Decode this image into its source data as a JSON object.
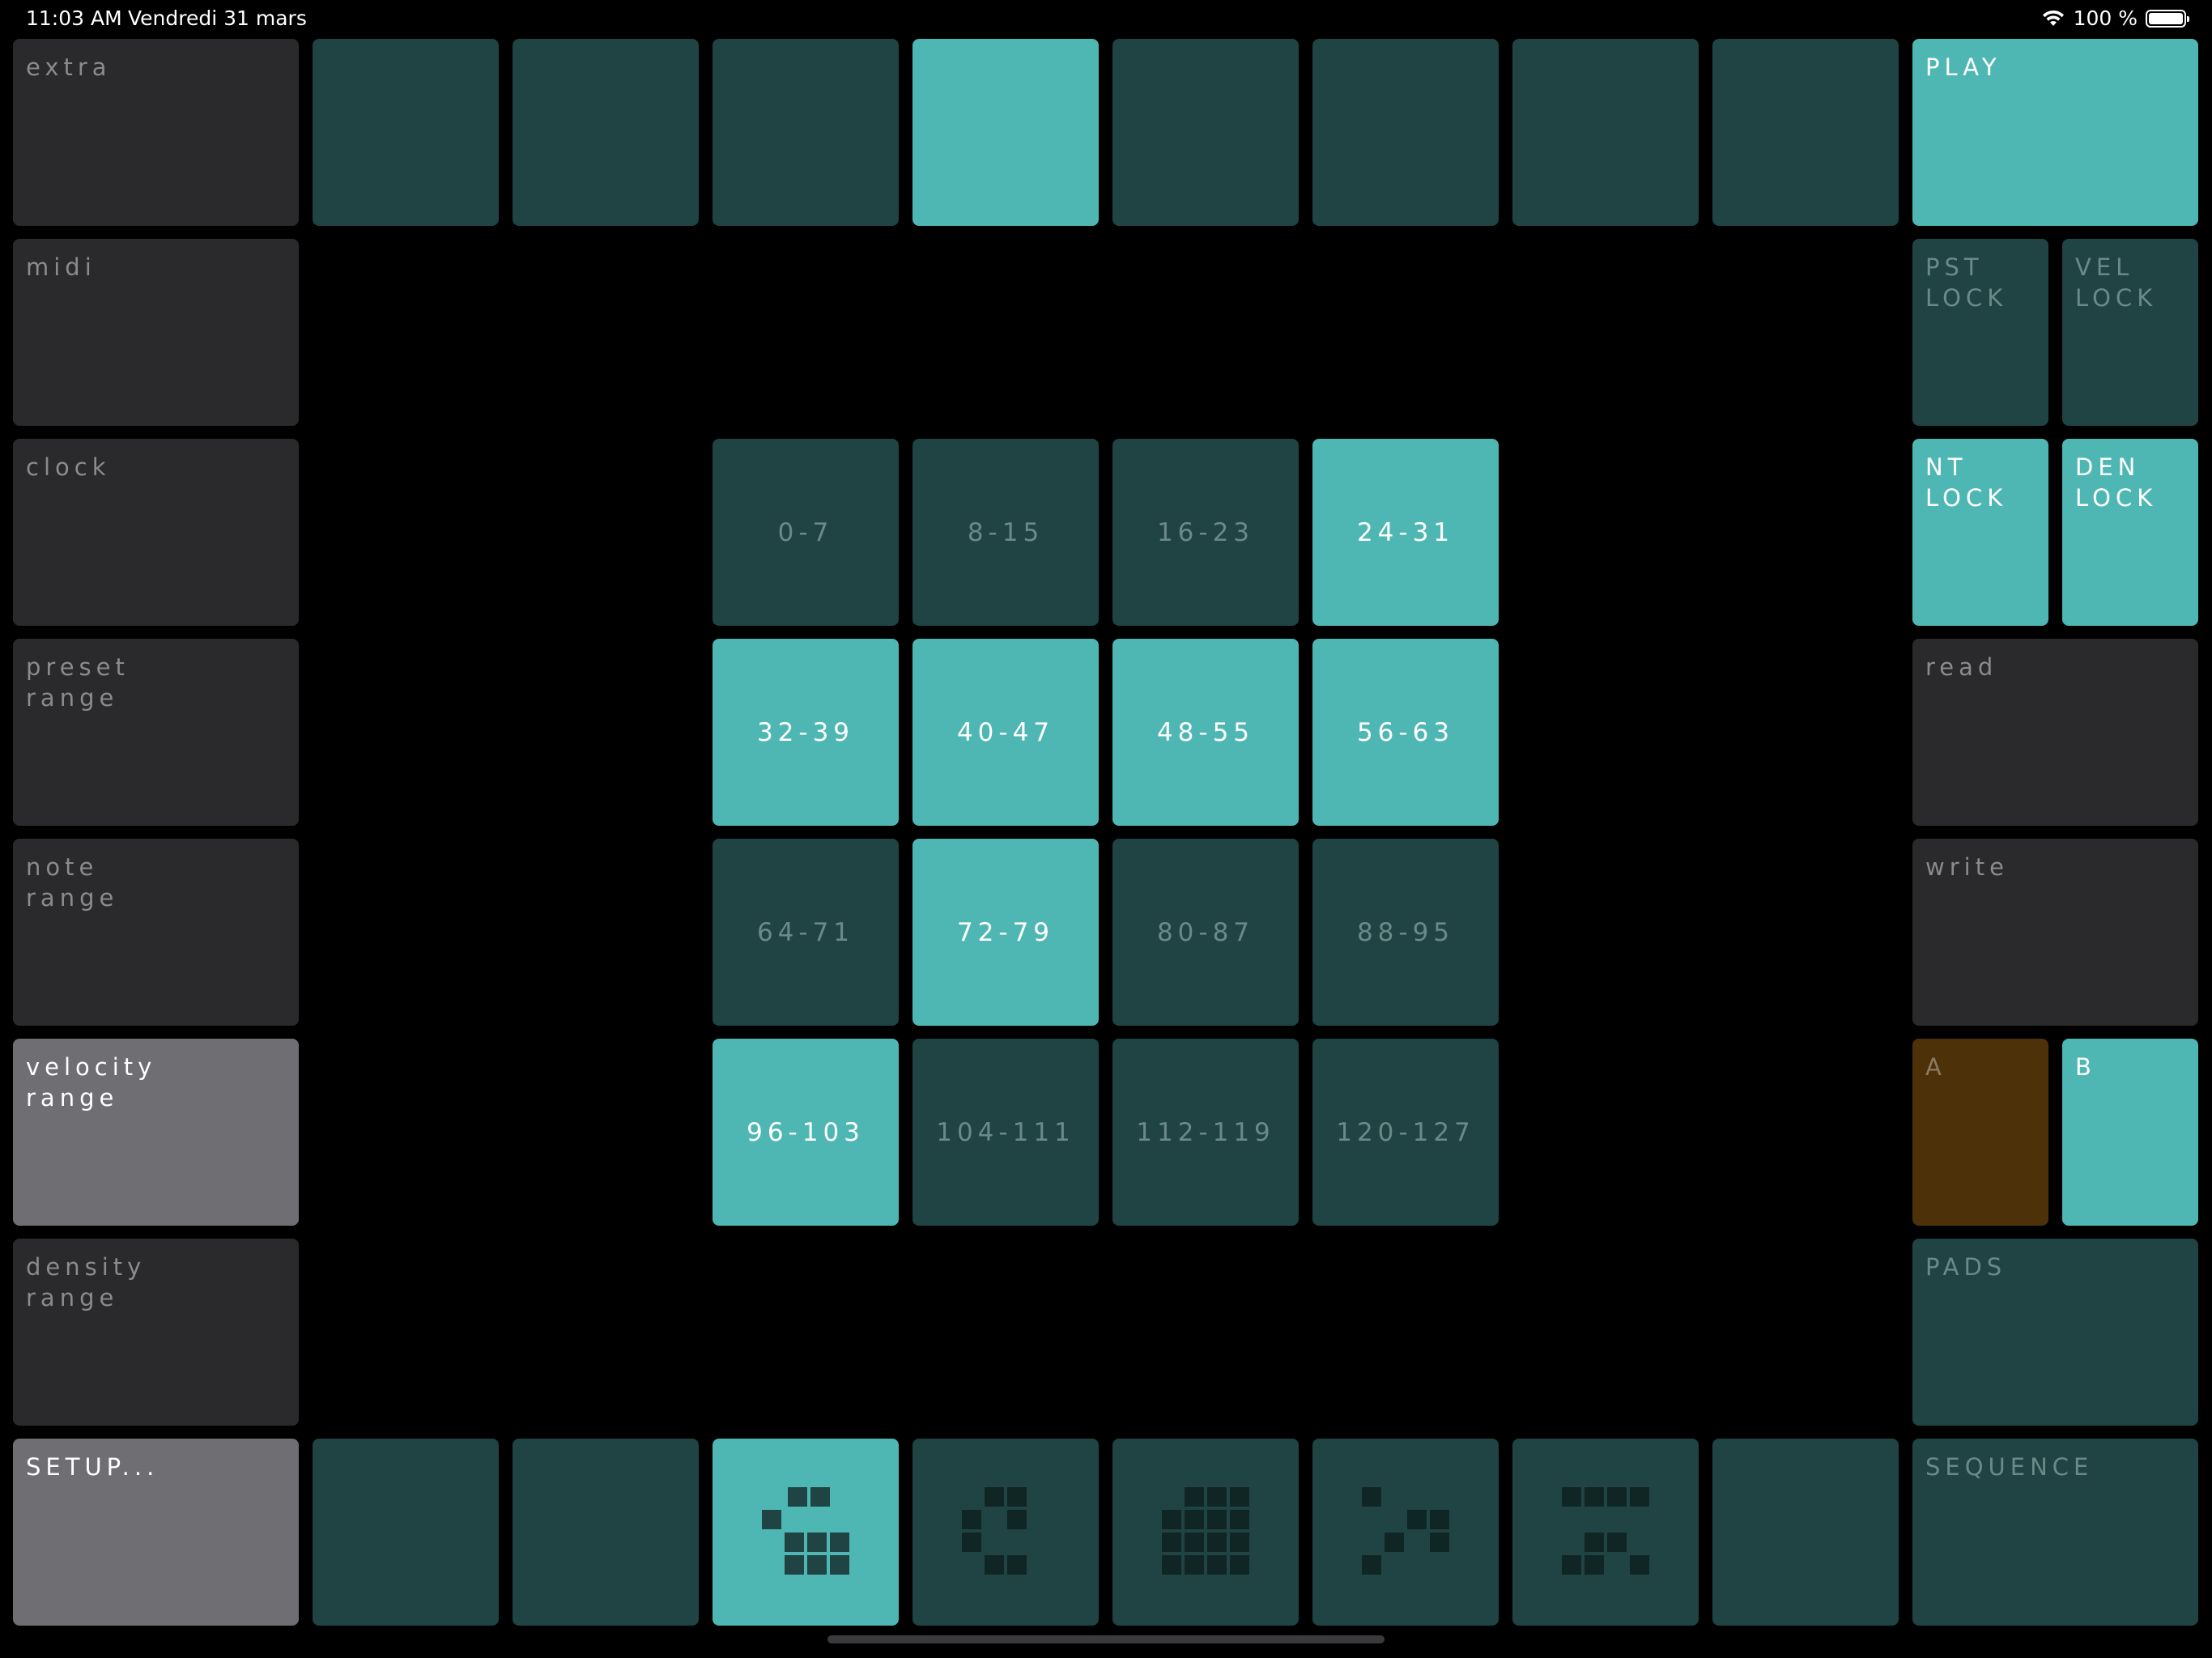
{
  "status_bar": {
    "time": "11:03 AM",
    "date": "Vendredi 31 mars",
    "battery": "100 %"
  },
  "left_column": [
    {
      "label": "extra",
      "active": false
    },
    {
      "label": "midi",
      "active": false
    },
    {
      "label": "clock",
      "active": false
    },
    {
      "label": "preset\nrange",
      "active": false
    },
    {
      "label": "note\nrange",
      "active": false
    },
    {
      "label": "velocity\nrange",
      "active": true
    },
    {
      "label": "density\nrange",
      "active": false
    },
    {
      "label": "SETUP...",
      "active": true
    }
  ],
  "top_row": [
    {
      "active": false
    },
    {
      "active": false
    },
    {
      "active": false
    },
    {
      "active": true
    },
    {
      "active": false
    },
    {
      "active": false
    },
    {
      "active": false
    },
    {
      "active": false
    }
  ],
  "velocity_ranges": [
    {
      "label": "0-7",
      "active": false
    },
    {
      "label": "8-15",
      "active": false
    },
    {
      "label": "16-23",
      "active": false
    },
    {
      "label": "24-31",
      "active": true
    },
    {
      "label": "32-39",
      "active": true
    },
    {
      "label": "40-47",
      "active": true
    },
    {
      "label": "48-55",
      "active": true
    },
    {
      "label": "56-63",
      "active": true
    },
    {
      "label": "64-71",
      "active": false
    },
    {
      "label": "72-79",
      "active": true
    },
    {
      "label": "80-87",
      "active": false
    },
    {
      "label": "88-95",
      "active": false
    },
    {
      "label": "96-103",
      "active": true
    },
    {
      "label": "104-111",
      "active": false
    },
    {
      "label": "112-119",
      "active": false
    },
    {
      "label": "120-127",
      "active": false
    }
  ],
  "right_column": {
    "play": "PLAY",
    "pst_lock": "PST\nLOCK",
    "vel_lock": "VEL\nLOCK",
    "nt_lock": "NT\nLOCK",
    "den_lock": "DEN\nLOCK",
    "read": "read",
    "write": "write",
    "a": "A",
    "b": "B",
    "pads": "PADS",
    "sequence": "SEQUENCE"
  },
  "bottom_row": [
    {
      "pattern": "blank-1",
      "active": false
    },
    {
      "pattern": "blank-2",
      "active": false
    },
    {
      "pattern": "pattern-1",
      "active": true
    },
    {
      "pattern": "pattern-2",
      "active": false
    },
    {
      "pattern": "pattern-3",
      "active": false
    },
    {
      "pattern": "pattern-4",
      "active": false
    },
    {
      "pattern": "pattern-5",
      "active": false
    },
    {
      "pattern": "blank-3",
      "active": false
    }
  ],
  "colors": {
    "teal_on": "#4fb7b3",
    "teal_off": "#1f4443",
    "gray_off": "#2a2a2c",
    "gray_on": "#6e6e73",
    "brown": "#4d3108"
  }
}
